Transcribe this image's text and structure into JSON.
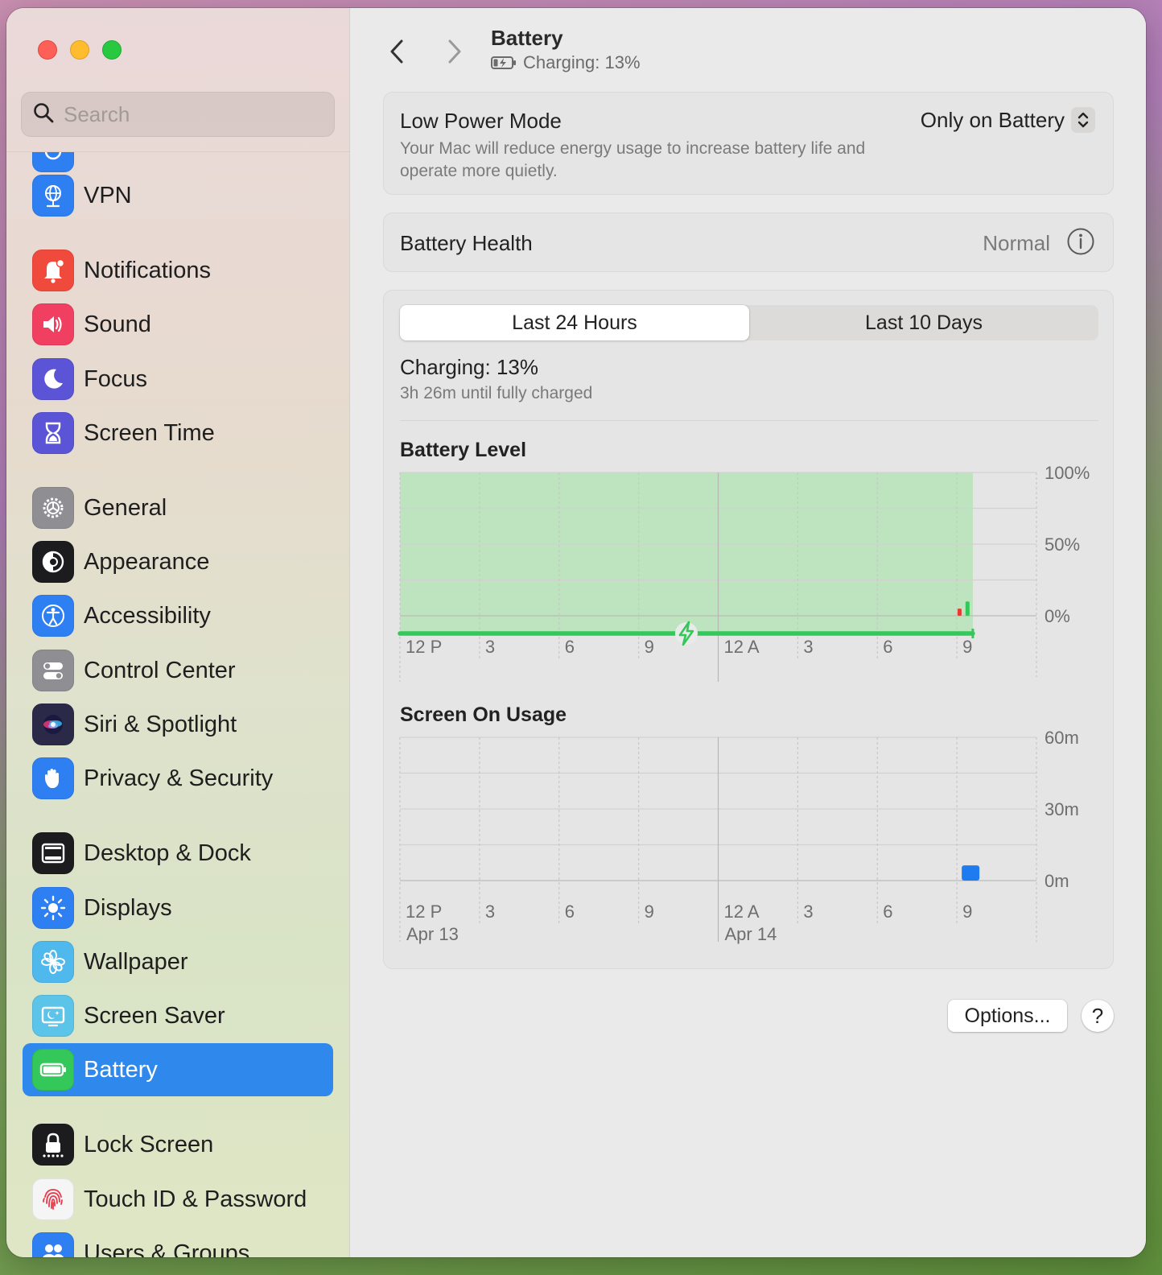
{
  "window": {
    "search": {
      "placeholder": "Search"
    },
    "sidebar": {
      "items": [
        {
          "label": "",
          "icon": "network-icon",
          "color": "#2e7ff2"
        },
        {
          "label": "VPN",
          "icon": "vpn-globe-icon",
          "color": "#2e7ff2"
        },
        {
          "label": "Notifications",
          "icon": "bell-icon",
          "color": "#f04a3c"
        },
        {
          "label": "Sound",
          "icon": "speaker-icon",
          "color": "#f03f60"
        },
        {
          "label": "Focus",
          "icon": "moon-icon",
          "color": "#5b54d6"
        },
        {
          "label": "Screen Time",
          "icon": "hourglass-icon",
          "color": "#5b54d6"
        },
        {
          "label": "General",
          "icon": "gear-icon",
          "color": "#8e8e93"
        },
        {
          "label": "Appearance",
          "icon": "appearance-icon",
          "color": "#1c1c1e"
        },
        {
          "label": "Accessibility",
          "icon": "accessibility-icon",
          "color": "#2e7ff2"
        },
        {
          "label": "Control Center",
          "icon": "toggles-icon",
          "color": "#8e8e93"
        },
        {
          "label": "Siri & Spotlight",
          "icon": "siri-icon",
          "color": "#2a2a48"
        },
        {
          "label": "Privacy & Security",
          "icon": "hand-icon",
          "color": "#2e7ff2"
        },
        {
          "label": "Desktop & Dock",
          "icon": "dock-icon",
          "color": "#1c1c1e"
        },
        {
          "label": "Displays",
          "icon": "sun-icon",
          "color": "#2e7ff2"
        },
        {
          "label": "Wallpaper",
          "icon": "flower-icon",
          "color": "#4fb8ec"
        },
        {
          "label": "Screen Saver",
          "icon": "screen-saver-icon",
          "color": "#5bc4e8"
        },
        {
          "label": "Battery",
          "icon": "battery-icon",
          "color": "#34c759",
          "selected": true
        },
        {
          "label": "Lock Screen",
          "icon": "lock-icon",
          "color": "#1c1c1e"
        },
        {
          "label": "Touch ID & Password",
          "icon": "fingerprint-icon",
          "color": "#f5f5f5"
        },
        {
          "label": "Users & Groups",
          "icon": "users-icon",
          "color": "#2e7ff2"
        }
      ]
    },
    "header": {
      "title": "Battery",
      "status": "Charging: 13%"
    },
    "low_power_mode": {
      "label": "Low Power Mode",
      "description": "Your Mac will reduce energy usage to increase battery life and operate more quietly.",
      "value": "Only on Battery"
    },
    "battery_health": {
      "label": "Battery Health",
      "value": "Normal"
    },
    "usage": {
      "tabs": [
        "Last 24 Hours",
        "Last 10 Days"
      ],
      "active_tab": 0,
      "charging_title": "Charging: 13%",
      "charging_subtitle": "3h 26m until fully charged"
    },
    "footer": {
      "options_label": "Options...",
      "help_label": "?"
    }
  },
  "chart_data": [
    {
      "type": "area",
      "title": "Battery Level",
      "x": [
        "12 P",
        "3",
        "6",
        "9",
        "12 A",
        "3",
        "6",
        "9"
      ],
      "y_ticks": [
        "100%",
        "50%",
        "0%"
      ],
      "ylim": [
        0,
        100
      ],
      "charging_shaded_until_hour": 21.6,
      "level_bars": [
        {
          "hour": 21.1,
          "value": 5,
          "color": "#e53b30"
        },
        {
          "hour": 21.4,
          "value": 10,
          "color": "#34c759"
        }
      ],
      "colors": {
        "charging_fill": "#bde3bf",
        "charging_line": "#34c759"
      }
    },
    {
      "type": "bar",
      "title": "Screen On Usage",
      "x": [
        "12 P",
        "3",
        "6",
        "9",
        "12 A",
        "3",
        "6",
        "9"
      ],
      "date_labels": [
        "Apr 13",
        "Apr 14"
      ],
      "y_ticks": [
        "60m",
        "30m",
        "0m"
      ],
      "ylim": [
        0,
        60
      ],
      "values": [
        {
          "hour": 21.0,
          "minutes": 5
        }
      ],
      "colors": {
        "bar": "#1f7cf0"
      }
    }
  ]
}
